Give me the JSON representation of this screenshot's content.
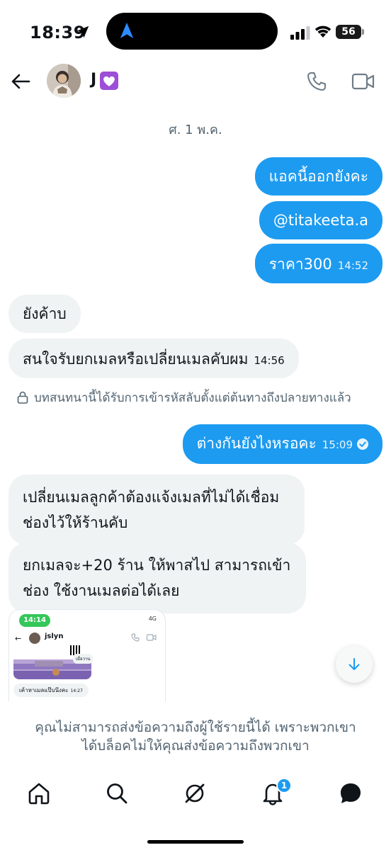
{
  "status_bar": {
    "time": "18:39",
    "battery": "56"
  },
  "header": {
    "contact_name": "J"
  },
  "date_separator": "ศ. 1 พ.ค.",
  "messages": [
    {
      "dir": "out",
      "text": "แอคนี้ออกยังคะ",
      "time": ""
    },
    {
      "dir": "out",
      "text": "@titakeeta.a",
      "time": ""
    },
    {
      "dir": "out",
      "text": "ราคา300",
      "time": "14:52"
    },
    {
      "dir": "in",
      "text": "ยังค้าบ",
      "time": ""
    },
    {
      "dir": "in",
      "text": "สนใจรับยกเมลหรือเปลี่ยนเมลคับผม",
      "time": "14:56"
    },
    {
      "dir": "out",
      "text": "ต่างกันยังไงหรอคะ",
      "time": "15:09"
    },
    {
      "dir": "in",
      "text": "เปลี่ยนเมลลูกค้าต้องแจ้งเมลที่ไม่ได้เชื่อมช่องไว้ให้ร้านคับ",
      "time": ""
    },
    {
      "dir": "in",
      "text": "ยกเมลจะ+20 ร้าน ให้พาสไป สามารถเข้าช่อง ใช้งานเมลต่อได้เลย",
      "time": ""
    }
  ],
  "encryption_notice": "บทสนทนานี้ได้รับการเข้ารหัสลับตั้งแต่ต้นทางถึงปลายทางแล้ว",
  "attachment": {
    "time": "14:14",
    "network": "4G",
    "name": "jslyn",
    "reply_label": "เมื่อวาน",
    "bubble_text": "เค้าหาเมลแป๊บนึงคะ",
    "bubble_time": "14:27"
  },
  "blocked_notice": {
    "line1": "คุณไม่สามารถส่งข้อความถึงผู้ใช้รายนี้ได้ เพราะพวกเขา",
    "line2": "ได้บล็อคไม่ให้คุณส่งข้อความถึงพวกเขา"
  },
  "nav": {
    "notification_count": "1"
  },
  "colors": {
    "accent": "#1d9bf0",
    "incoming": "#eff3f4",
    "secondary_text": "#536471"
  },
  "icons": [
    "location-arrow-icon",
    "navigation-icon",
    "cellular-signal-icon",
    "wifi-icon",
    "back-arrow-icon",
    "heart-emoji-icon",
    "phone-icon",
    "video-icon",
    "lock-icon",
    "check-circle-icon",
    "arrow-down-icon",
    "home-icon",
    "search-icon",
    "grok-icon",
    "bell-icon",
    "messages-icon"
  ]
}
